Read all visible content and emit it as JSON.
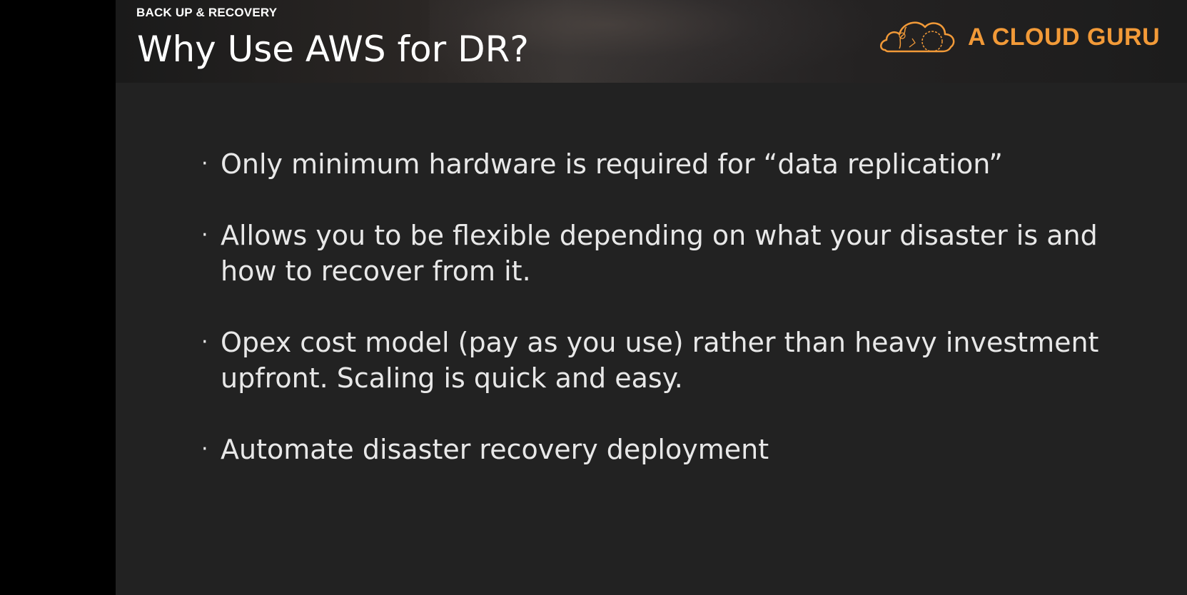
{
  "header": {
    "section_label": "BACK UP & RECOVERY",
    "title": "Why Use AWS for DR?",
    "logo_text": "A CLOUD GURU",
    "logo_icon": "cloud-icon",
    "accent_color": "#f29a38"
  },
  "bullets": [
    {
      "text": "Only minimum hardware is required for “data replication”"
    },
    {
      "text": "Allows you to be flexible depending on what your disaster is and how to recover from it."
    },
    {
      "text": "Opex cost model (pay as you use) rather than heavy investment upfront. Scaling is quick and easy."
    },
    {
      "text": "Automate disaster recovery deployment"
    }
  ],
  "bullet_glyph": "·"
}
